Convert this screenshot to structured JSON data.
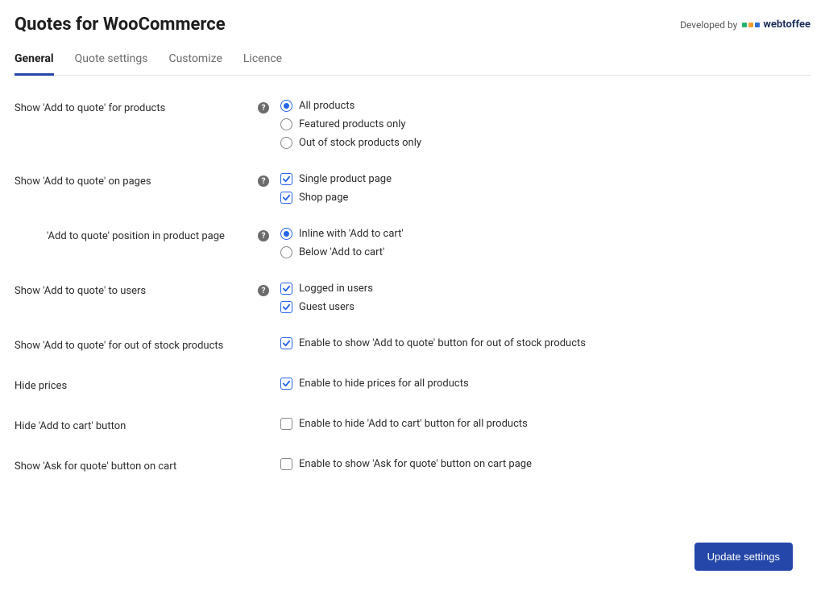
{
  "header": {
    "title": "Quotes for WooCommerce",
    "developed_by": "Developed by",
    "brand": "webtoffee"
  },
  "tabs": [
    {
      "label": "General",
      "active": true
    },
    {
      "label": "Quote settings",
      "active": false
    },
    {
      "label": "Customize",
      "active": false
    },
    {
      "label": "Licence",
      "active": false
    }
  ],
  "settings": {
    "show_products": {
      "label": "Show 'Add to quote' for products",
      "help": true,
      "options": [
        {
          "label": "All products",
          "checked": true
        },
        {
          "label": "Featured products only",
          "checked": false
        },
        {
          "label": "Out of stock products only",
          "checked": false
        }
      ]
    },
    "show_pages": {
      "label": "Show 'Add to quote' on pages",
      "help": true,
      "options": [
        {
          "label": "Single product page",
          "checked": true
        },
        {
          "label": "Shop page",
          "checked": true
        }
      ]
    },
    "position": {
      "label": "'Add to quote' position in product page",
      "help": true,
      "options": [
        {
          "label": "Inline with 'Add to cart'",
          "checked": true
        },
        {
          "label": "Below 'Add to cart'",
          "checked": false
        }
      ]
    },
    "show_users": {
      "label": "Show 'Add to quote' to users",
      "help": true,
      "options": [
        {
          "label": "Logged in users",
          "checked": true
        },
        {
          "label": "Guest users",
          "checked": true
        }
      ]
    },
    "out_of_stock": {
      "label": "Show 'Add to quote' for out of stock products",
      "option_label": "Enable to show 'Add to quote' button for out of stock products",
      "checked": true
    },
    "hide_prices": {
      "label": "Hide prices",
      "option_label": "Enable to hide prices for all products",
      "checked": true
    },
    "hide_add_to_cart": {
      "label": "Hide 'Add to cart' button",
      "option_label": "Enable to hide 'Add to cart' button for all products",
      "checked": false
    },
    "ask_for_quote": {
      "label": "Show 'Ask for quote' button on cart",
      "option_label": "Enable to show 'Ask for quote' button on cart page",
      "checked": false
    }
  },
  "footer": {
    "save_label": "Update settings"
  },
  "colors": {
    "primary": "#2547a9",
    "accent": "#2563eb"
  }
}
